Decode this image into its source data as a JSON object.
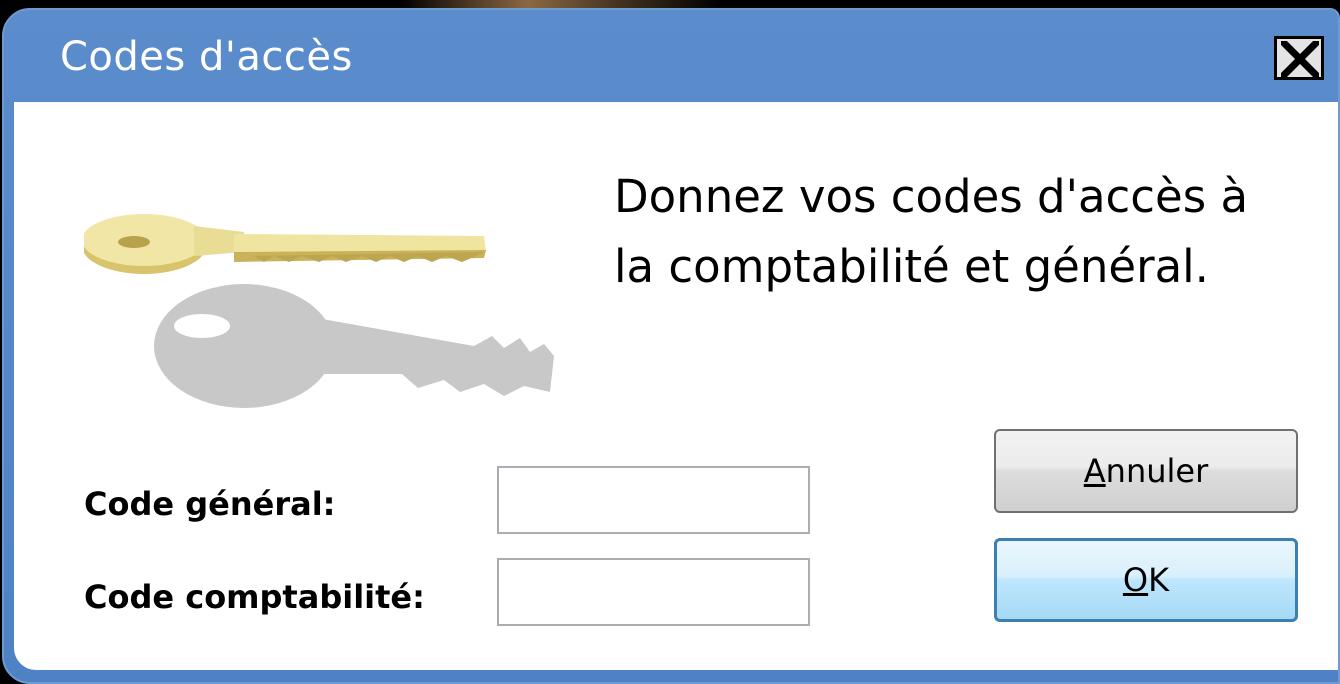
{
  "window": {
    "title": "Codes d'accès",
    "close_glyph": "X"
  },
  "prompt": {
    "line1": "Donnez vos codes d'accès à",
    "line2": "la comptabilité et général."
  },
  "icons": {
    "key": "key-icon",
    "close": "close-icon"
  },
  "fields": {
    "general": {
      "label": "Code général:",
      "value": "",
      "placeholder": ""
    },
    "comptabilite": {
      "label": "Code comptabilité:",
      "value": "",
      "placeholder": ""
    }
  },
  "buttons": {
    "cancel": {
      "mnemonic": "A",
      "rest": "nnuler"
    },
    "ok": {
      "mnemonic": "O",
      "rest": "K"
    }
  },
  "colors": {
    "titlebar": "#5b8ccc",
    "default_button_border": "#3c7fb1",
    "key_gold": "#e8d98a",
    "key_shadow": "#c8c8c8"
  }
}
